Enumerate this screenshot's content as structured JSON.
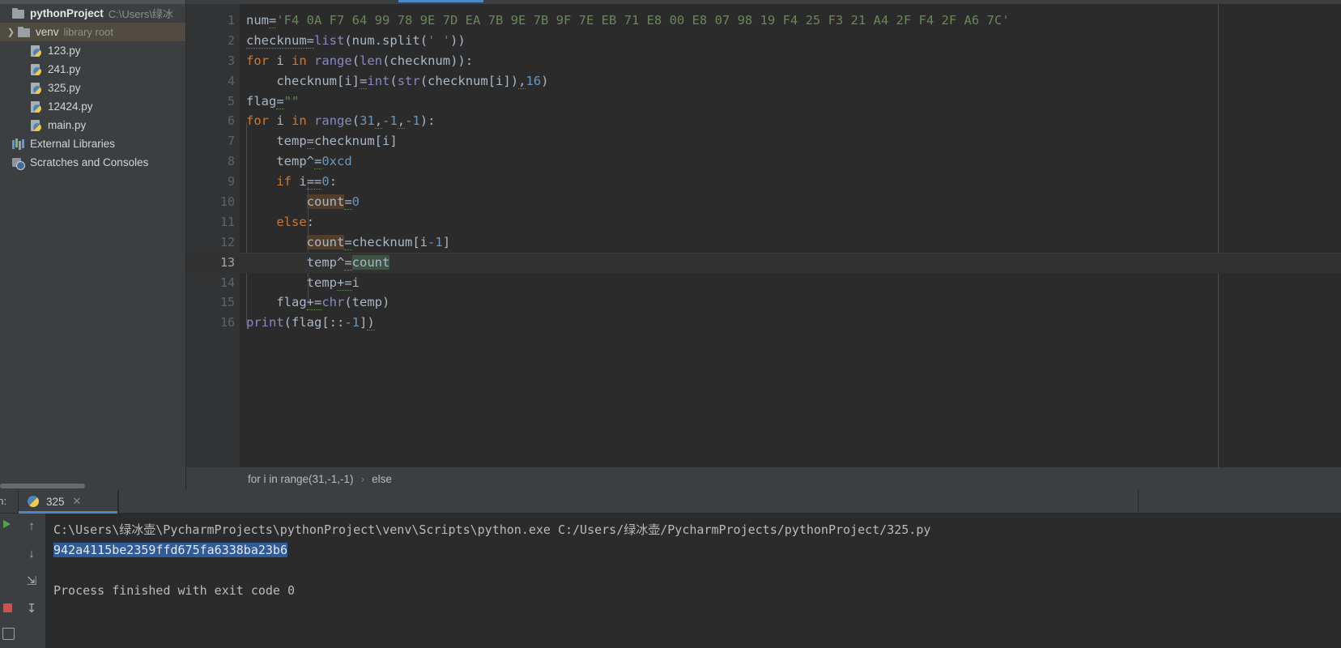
{
  "project_tree": {
    "root": {
      "name": "pythonProject",
      "path": "C:\\Users\\绿冰"
    },
    "items": [
      {
        "name": "venv",
        "tag": "library root",
        "icon": "folder-icon",
        "selected": true,
        "expandable": true
      },
      {
        "name": "123.py",
        "icon": "python-file-icon"
      },
      {
        "name": "241.py",
        "icon": "python-file-icon"
      },
      {
        "name": "325.py",
        "icon": "python-file-icon"
      },
      {
        "name": "12424.py",
        "icon": "python-file-icon"
      },
      {
        "name": "main.py",
        "icon": "python-file-icon"
      }
    ],
    "external_libraries": "External Libraries",
    "scratches": "Scratches and Consoles"
  },
  "editor": {
    "lines": [
      {
        "n": "1",
        "text": "num='F4 0A F7 64 99 78 9E 7D EA 7B 9E 7B 9F 7E EB 71 E8 00 E8 07 98 19 F4 25 F3 21 A4 2F F4 2F A6 7C'"
      },
      {
        "n": "2",
        "text": "checknum=list(num.split(' '))"
      },
      {
        "n": "3",
        "text": "for i in range(len(checknum)):"
      },
      {
        "n": "4",
        "text": "    checknum[i]=int(str(checknum[i]),16)"
      },
      {
        "n": "5",
        "text": "flag=\"\""
      },
      {
        "n": "6",
        "text": "for i in range(31,-1,-1):"
      },
      {
        "n": "7",
        "text": "    temp=checknum[i]"
      },
      {
        "n": "8",
        "text": "    temp^=0xcd"
      },
      {
        "n": "9",
        "text": "    if i==0:"
      },
      {
        "n": "10",
        "text": "        count=0"
      },
      {
        "n": "11",
        "text": "    else:"
      },
      {
        "n": "12",
        "text": "        count=checknum[i-1]"
      },
      {
        "n": "13",
        "text": "        temp^=count"
      },
      {
        "n": "14",
        "text": "        temp+=i"
      },
      {
        "n": "15",
        "text": "    flag+=chr(temp)"
      },
      {
        "n": "16",
        "text": "print(flag[::-1])"
      }
    ],
    "current_line": "13",
    "breadcrumb": {
      "scope": "for i in range(31,-1,-1)",
      "separator": "›",
      "child": "else"
    }
  },
  "run_panel": {
    "label": "un:",
    "tab": {
      "title": "325",
      "close": "✕",
      "icon": "python-icon"
    },
    "console": {
      "command": "C:\\Users\\绿冰壶\\PycharmProjects\\pythonProject\\venv\\Scripts\\python.exe C:/Users/绿冰壶/PycharmProjects/pythonProject/325.py",
      "output_selected": "942a4115be2359ffd675fa6338ba23b6",
      "status": "Process finished with exit code 0"
    },
    "toolbar_icons": [
      "up-arrow-icon",
      "down-arrow-icon",
      "soft-wrap-icon",
      "scroll-to-end-icon"
    ]
  },
  "colors": {
    "editor_bg": "#2b2b2b",
    "panel_bg": "#3c3f41",
    "gutter_bg": "#313335",
    "accent": "#4a88c7",
    "string": "#6a8759",
    "keyword": "#cc7832",
    "number": "#6897bb",
    "function": "#8888c6",
    "selection": "#2f5b99",
    "tree_selected": "#4f4b41"
  }
}
